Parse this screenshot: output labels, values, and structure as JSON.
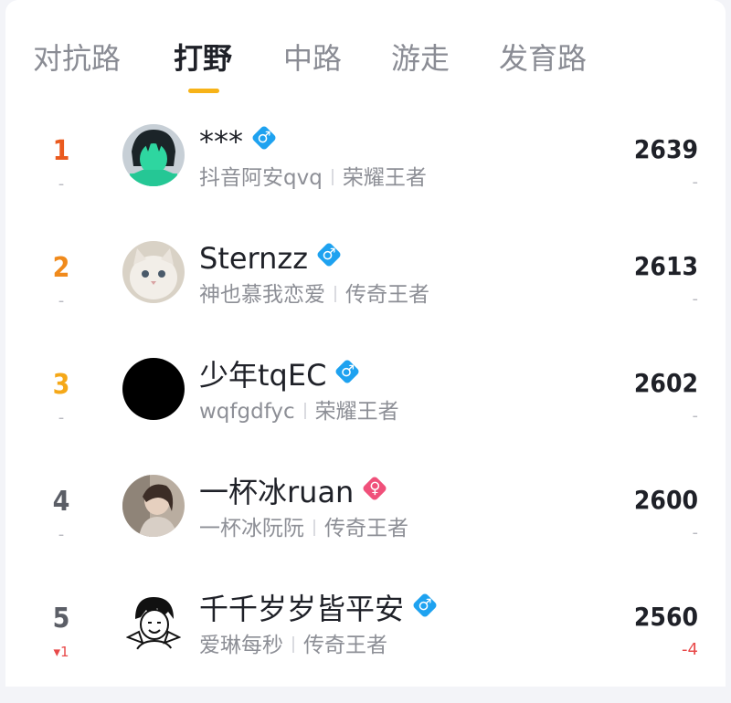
{
  "tabs": [
    {
      "label": "对抗路"
    },
    {
      "label": "打野"
    },
    {
      "label": "中路"
    },
    {
      "label": "游走"
    },
    {
      "label": "发育路"
    }
  ],
  "active_tab": "打野",
  "colors": {
    "accent_underline": "#f7b318",
    "rank1": "#ea5a1e",
    "rank2": "#f08a1c",
    "rank3": "#f5a818",
    "rank_other": "#5b5e66",
    "male": "#1ea2f0",
    "female": "#f0507a",
    "negative": "#e84949"
  },
  "players": [
    {
      "rank": "1",
      "rank_change": "-",
      "name": "***",
      "gender": "male",
      "gender_icon": "male-icon",
      "nickname": "抖音阿安qvq",
      "tier": "荣耀王者",
      "score": "2639",
      "score_change": "-",
      "avatar": "green-character-avatar"
    },
    {
      "rank": "2",
      "rank_change": "-",
      "name": "Sternzz",
      "gender": "male",
      "gender_icon": "male-icon",
      "nickname": "神也慕我恋爱",
      "tier": "传奇王者",
      "score": "2613",
      "score_change": "-",
      "avatar": "cat-avatar"
    },
    {
      "rank": "3",
      "rank_change": "-",
      "name": "少年tqEC",
      "gender": "male",
      "gender_icon": "male-icon",
      "nickname": "wqfgdfyc",
      "tier": "荣耀王者",
      "score": "2602",
      "score_change": "-",
      "avatar": "black-avatar"
    },
    {
      "rank": "4",
      "rank_change": "-",
      "name": "一杯冰ruan",
      "gender": "female",
      "gender_icon": "female-icon",
      "nickname": "一杯冰阮阮",
      "tier": "传奇王者",
      "score": "2600",
      "score_change": "-",
      "avatar": "photo-avatar"
    },
    {
      "rank": "5",
      "rank_change": "▾1",
      "name": "千千岁岁皆平安",
      "gender": "male",
      "gender_icon": "male-icon",
      "nickname": "爱琳每秒",
      "tier": "传奇王者",
      "score": "2560",
      "score_change": "-4",
      "avatar": "sketch-avatar"
    }
  ]
}
